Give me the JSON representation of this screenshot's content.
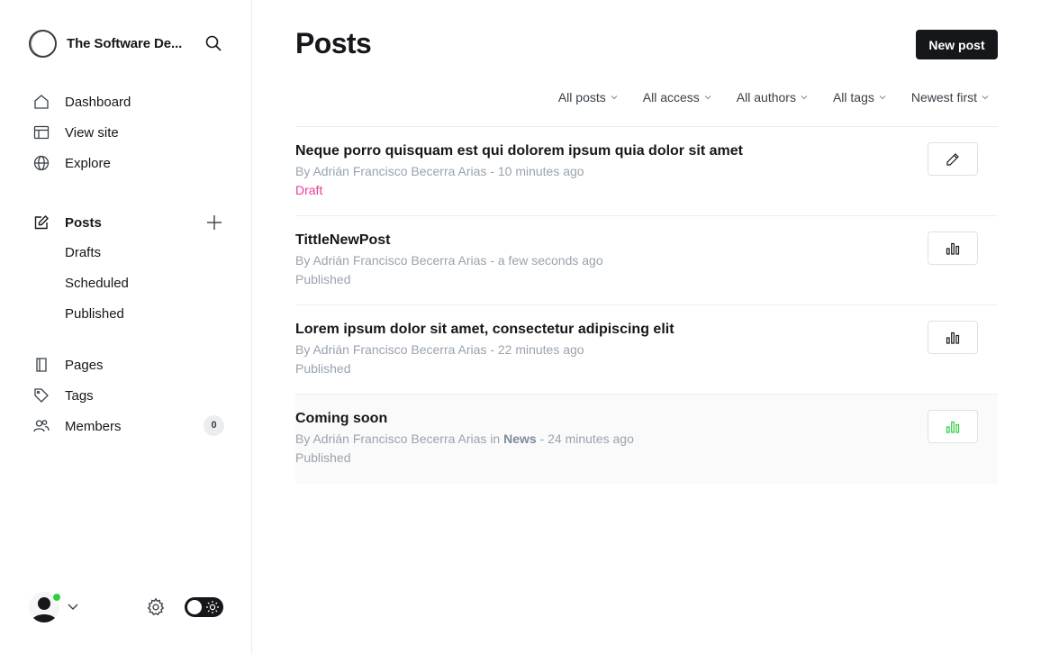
{
  "brand": {
    "title": "The Software De...",
    "search_icon": "search-icon"
  },
  "nav": {
    "dashboard": "Dashboard",
    "view_site": "View site",
    "explore": "Explore",
    "posts": "Posts",
    "drafts": "Drafts",
    "scheduled": "Scheduled",
    "published": "Published",
    "pages": "Pages",
    "tags": "Tags",
    "members": "Members",
    "members_count": "0"
  },
  "colors": {
    "accent": "#15171a",
    "draft": "#e83c98",
    "online": "#30cf43",
    "analytics_active": "#30cf43"
  },
  "header": {
    "title": "Posts",
    "new_post_label": "New post"
  },
  "filters": [
    "All posts",
    "All access",
    "All authors",
    "All tags",
    "Newest first"
  ],
  "posts": [
    {
      "title": "Neque porro quisquam est qui dolorem ipsum quia dolor sit amet",
      "author": "By Adrián Francisco Becerra Arias",
      "tag_prefix": "",
      "tag": "",
      "time": "- 10 minutes ago",
      "status": "Draft",
      "action_icon": "pencil-icon"
    },
    {
      "title": "TittleNewPost",
      "author": "By Adrián Francisco Becerra Arias",
      "tag_prefix": "",
      "tag": "",
      "time": "- a few seconds ago",
      "status": "Published",
      "action_icon": "analytics-icon"
    },
    {
      "title": "Lorem ipsum dolor sit amet, consectetur adipiscing elit",
      "author": "By Adrián Francisco Becerra Arias",
      "tag_prefix": "",
      "tag": "",
      "time": "- 22 minutes ago",
      "status": "Published",
      "action_icon": "analytics-icon"
    },
    {
      "title": "Coming soon",
      "author": "By Adrián Francisco Becerra Arias",
      "tag_prefix": " in ",
      "tag": "News",
      "time": "- 24 minutes ago",
      "status": "Published",
      "action_icon": "analytics-icon"
    }
  ]
}
